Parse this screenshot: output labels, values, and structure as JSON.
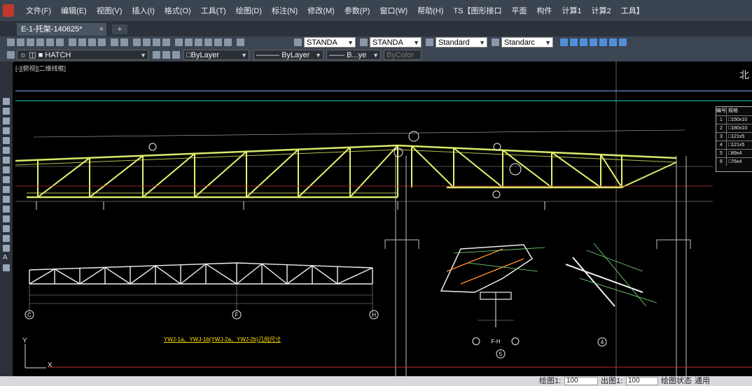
{
  "menubar": {
    "items": [
      "文件(F)",
      "编辑(E)",
      "视图(V)",
      "插入(I)",
      "格式(O)",
      "工具(T)",
      "绘图(D)",
      "标注(N)",
      "修改(M)",
      "参数(P)",
      "窗口(W)",
      "帮助(H)",
      "TS【图形接口",
      "平面",
      "构件",
      "计算1",
      "计算2",
      "工具】"
    ]
  },
  "tabs": {
    "document_tab": "E-1-托架-140625*",
    "close_symbol": "×",
    "new_tab_symbol": "+"
  },
  "toolbar_styles": {
    "text_style": "STANDA",
    "dim_style": "STANDA",
    "table_style": "Standard",
    "multileader_style": "Standarc"
  },
  "toolbar_properties": {
    "layer": "HATCH",
    "color": "ByLayer",
    "linetype": "ByLayer",
    "lineweight": "B...ye",
    "plotstyle": "ByColor"
  },
  "viewport": {
    "label": "[-][俯视][二维线框]",
    "north_label": "北"
  },
  "drawing": {
    "axis_labels": [
      "C",
      "F",
      "H"
    ],
    "detail_label_1": "F-H",
    "detail_number_1": "5",
    "detail_number_2": "4",
    "caption": "YWJ-1a、YWJ-1b(YWJ-2a、YWJ-2b)几何尺寸",
    "ucs_y": "Y",
    "ucs_x": "X"
  },
  "legend_table": {
    "header": [
      "编号",
      "规格"
    ],
    "rows": [
      [
        "1",
        "□150x10"
      ],
      [
        "2",
        "□180x10"
      ],
      [
        "3",
        "□121x5"
      ],
      [
        "4",
        "□121x5"
      ],
      [
        "5",
        "□89x4"
      ],
      [
        "6",
        "□76x4"
      ]
    ]
  },
  "statusbar": {
    "plot_scale_label": "绘图1:",
    "plot_scale_value": "100",
    "print_scale_label": "出图1:",
    "print_scale_value": "100",
    "state_label": "绘图状态",
    "state_value": "通用"
  },
  "colors": {
    "truss": "#d8e86a",
    "truss_web": "#e8f070",
    "ref_line": "#00e0c0",
    "ref_line_2": "#8ab4ff",
    "detail_green": "#7fe07f",
    "detail_white": "#f0f0f0",
    "dim_line": "#a0a0a0"
  }
}
